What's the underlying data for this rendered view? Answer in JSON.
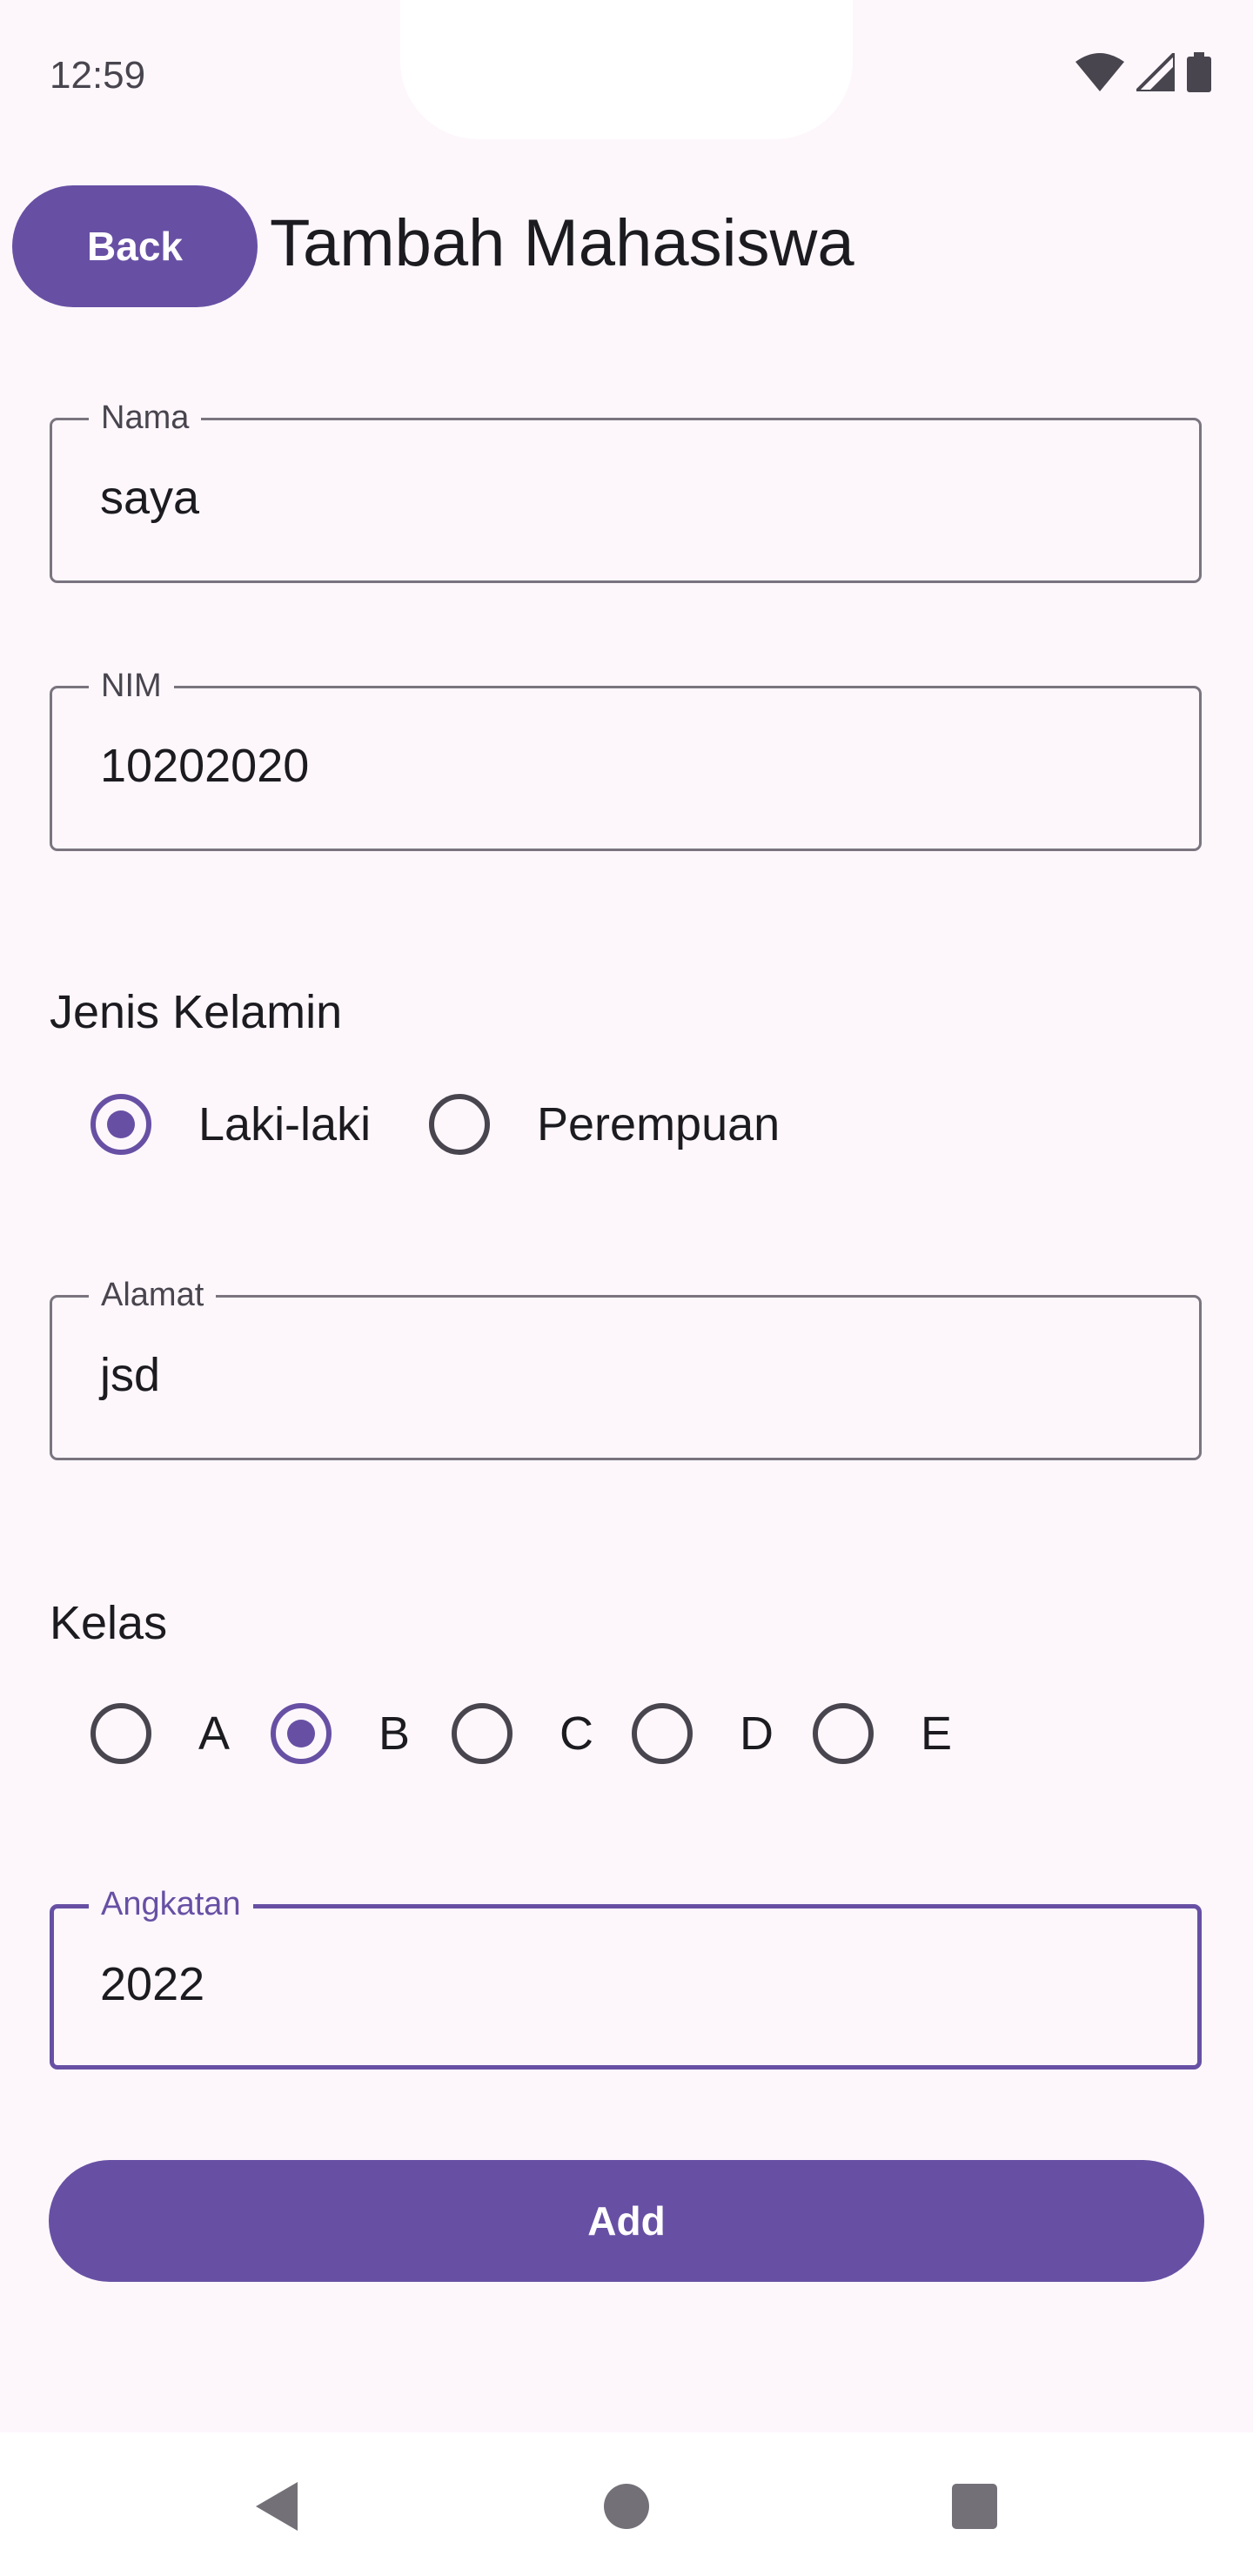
{
  "status_bar": {
    "time": "12:59",
    "icons": [
      "wifi-icon",
      "cell-signal-icon",
      "battery-icon"
    ]
  },
  "header": {
    "back_label": "Back",
    "title": "Tambah Mahasiswa"
  },
  "form": {
    "nama": {
      "label": "Nama",
      "value": "saya"
    },
    "nim": {
      "label": "NIM",
      "value": "10202020"
    },
    "jenis_kelamin": {
      "label": "Jenis Kelamin",
      "options": [
        "Laki-laki",
        "Perempuan"
      ],
      "selected": "Laki-laki"
    },
    "alamat": {
      "label": "Alamat",
      "value": "jsd"
    },
    "kelas": {
      "label": "Kelas",
      "options": [
        "A",
        "B",
        "C",
        "D",
        "E"
      ],
      "selected": "B"
    },
    "angkatan": {
      "label": "Angkatan",
      "value": "2022",
      "focused": true
    },
    "submit_label": "Add"
  },
  "nav_bar": {
    "icons": [
      "back-triangle-icon",
      "home-circle-icon",
      "recents-square-icon"
    ]
  },
  "colors": {
    "accent": "#6750a4",
    "background": "#fdf7fc",
    "outline": "#79747e",
    "text": "#1c1b1f"
  }
}
